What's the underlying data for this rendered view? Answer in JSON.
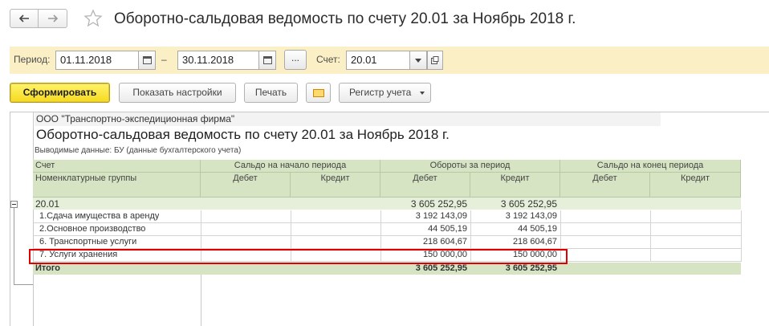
{
  "window": {
    "title": "Оборотно-сальдовая ведомость по счету 20.01 за Ноябрь 2018 г."
  },
  "period_panel": {
    "period_label": "Период:",
    "date_from": "01.11.2018",
    "dash": "–",
    "date_to": "30.11.2018",
    "dots_label": "...",
    "account_label": "Счет:",
    "account_value": "20.01"
  },
  "toolbar": {
    "generate_label": "Сформировать",
    "settings_label": "Показать настройки",
    "print_label": "Печать",
    "register_label": "Регистр учета"
  },
  "report": {
    "org": "ООО \"Транспортно-экспедиционная фирма\"",
    "heading": "Оборотно-сальдовая ведомость по счету 20.01 за Ноябрь 2018 г.",
    "output": "Выводимые данные:  БУ (данные бухгалтерского учета)",
    "headers": {
      "account": "Счет",
      "nomenclature": "Номенклатурные группы",
      "opening": "Сальдо на начало периода",
      "turnover": "Обороты за период",
      "closing": "Сальдо на конец периода",
      "debit": "Дебет",
      "credit": "Кредит"
    },
    "group": {
      "name": "20.01",
      "turnover_debit": "3 605 252,95",
      "turnover_credit": "3 605 252,95"
    },
    "rows": [
      {
        "name": "1.Сдача имущества в аренду",
        "turnover_debit": "3 192 143,09",
        "turnover_credit": "3 192 143,09"
      },
      {
        "name": "2.Основное производство",
        "turnover_debit": "44 505,19",
        "turnover_credit": "44 505,19"
      },
      {
        "name": "6. Транспортные услуги",
        "turnover_debit": "218 604,67",
        "turnover_credit": "218 604,67"
      },
      {
        "name": "7. Услуги хранения",
        "turnover_debit": "150 000,00",
        "turnover_credit": "150 000,00"
      }
    ],
    "total": {
      "name": "Итого",
      "turnover_debit": "3 605 252,95",
      "turnover_credit": "3 605 252,95"
    }
  },
  "colors": {
    "panel_bg": "#fbf0c5",
    "primary_button": "#f6da1f",
    "header_bg": "#d6e4c4",
    "group_bg": "#e5efd9",
    "highlight": "#e00000"
  }
}
